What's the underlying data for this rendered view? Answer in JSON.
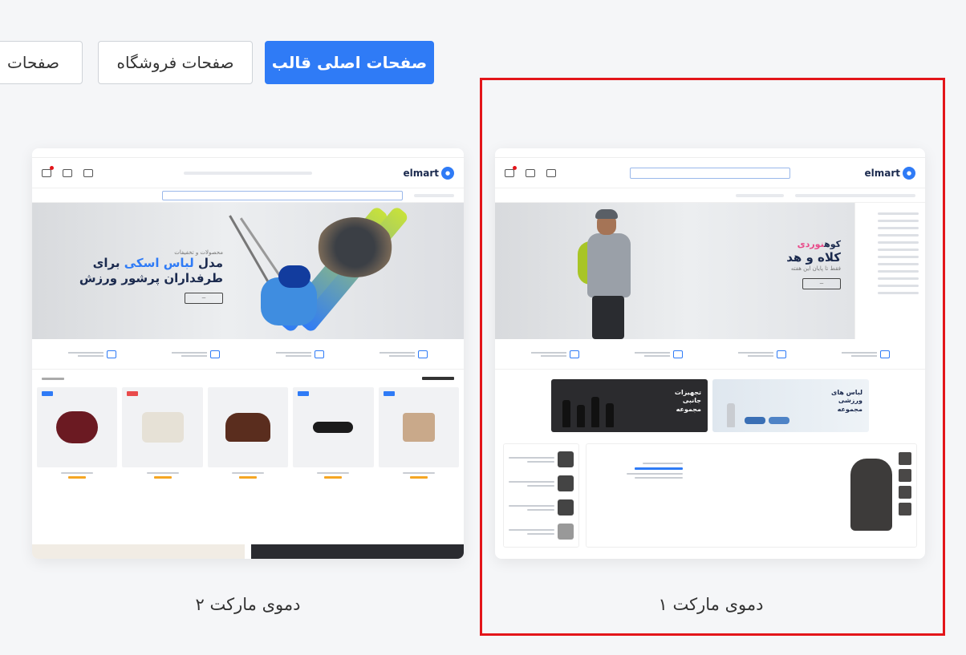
{
  "tabs": [
    {
      "label": "صفحات اصلی قالب",
      "active": true
    },
    {
      "label": "صفحات فروشگاه",
      "active": false
    },
    {
      "label": "صفحات",
      "active": false
    }
  ],
  "demos": [
    {
      "caption": "دموی مارکت ۱",
      "logo": "elmart",
      "hero": {
        "line1_prefix": "کوه",
        "line1_highlight": "نوردی",
        "line2": "کلاه و هد",
        "line3": "فقط تا پایان این هفته"
      },
      "banners": [
        {
          "text": "لباس های ورزشی مجموعه"
        },
        {
          "text": "تجهیزات جانبی مجموعه"
        }
      ],
      "selected": true
    },
    {
      "caption": "دموی مارکت ۲",
      "logo": "elmart",
      "hero": {
        "small": "محصولات و تخفیفات",
        "line1_prefix": "مدل",
        "line1_highlight": "لباس اسکی",
        "line1_suffix": "برای",
        "line2": "طرفداران پرشور ورزش"
      },
      "selected": false
    }
  ],
  "colors": {
    "accent": "#2f7bf6",
    "highlight": "#e3151a"
  }
}
